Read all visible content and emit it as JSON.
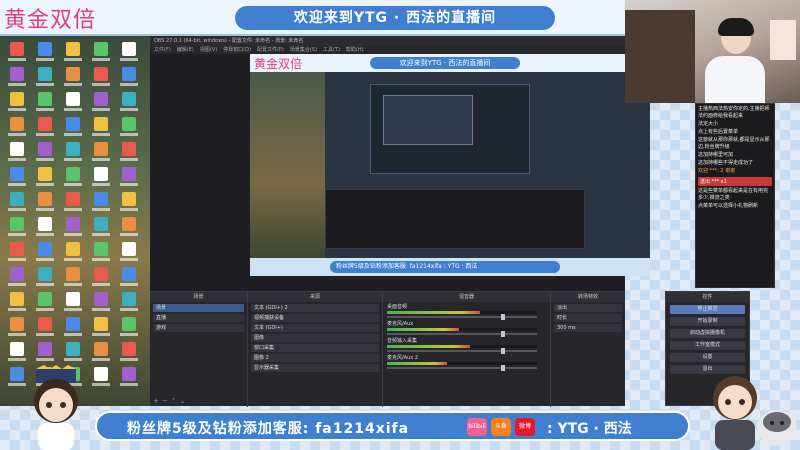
{
  "banner": {
    "promo_gold": "黄金双倍",
    "stream_title": "欢迎来到YTG · 西法的直播间"
  },
  "bottom_banner": {
    "fan_text": "粉丝牌5级及钻粉添加客服: fa1214xifa",
    "bilibili_label": "bilibili",
    "douyu_label": "斗鱼",
    "weibo_label": "微博",
    "weibo_account": ": YTG · 西法"
  },
  "preview": {
    "promo_gold": "黄金双倍",
    "stream_title": "欢迎来到YTG · 西法的直播间",
    "bottom_text": "粉丝牌5级及钻粉添加客服: fa1214xifa   : YTG · 西法"
  },
  "obs": {
    "window_title": "OBS 27.0.1 (64-bit, windows) - 配置文件: 未命名 - 场景: 未命名",
    "menu": [
      "文件(F)",
      "编辑(E)",
      "视图(V)",
      "停靠窗口(D)",
      "配置文件(P)",
      "场景集合(S)",
      "工具(T)",
      "帮助(H)"
    ],
    "docks": {
      "scenes": {
        "title": "场景",
        "items": [
          "场景",
          "直播",
          "游戏"
        ]
      },
      "sources": {
        "title": "来源",
        "items": [
          "文本 (GDI+) 2",
          "视频捕获设备",
          "文本 (GDI+)",
          "图像",
          "窗口采集",
          "图像 2",
          "显示器采集"
        ]
      },
      "mixer": {
        "title": "混音器",
        "tracks": [
          {
            "name": "桌面音频",
            "level": 0.62,
            "volume": 0.78
          },
          {
            "name": "麦克风/Aux",
            "level": 0.48,
            "volume": 0.78
          },
          {
            "name": "音频输入采集",
            "level": 0.55,
            "volume": 0.78
          },
          {
            "name": "麦克风/Aux 2",
            "level": 0.4,
            "volume": 0.78
          }
        ]
      },
      "transitions": {
        "title": "转场特效",
        "value": "淡出",
        "duration_label": "时长",
        "duration": "300 ms"
      },
      "controls": {
        "title": "控件",
        "buttons": [
          "停止推流",
          "开始录制",
          "启动虚拟摄像机",
          "工作室模式",
          "设置",
          "退出"
        ]
      }
    }
  },
  "chat": {
    "lines": [
      {
        "text": "主播热西法热安你定的,主播把师法约面修给我看起来",
        "style": "normal"
      },
      {
        "text": "法定大小",
        "style": "normal"
      },
      {
        "text": "点上有些后置菜单",
        "style": "normal"
      },
      {
        "text": "这窗就从那你那就,都是显示从那边,粉丝牌升级",
        "style": "normal"
      },
      {
        "text": "这加持哪里可加",
        "style": "normal"
      },
      {
        "text": "这加持哪些不得走成功了",
        "style": "normal"
      },
      {
        "text": "欢迎 ***: 2  谢谢",
        "style": "orange"
      },
      {
        "text": "这是些菜单都看起来是在有用完多少,推流之类",
        "style": "normal"
      },
      {
        "text": "点菜单可以选择小礼物刷新",
        "style": "normal"
      }
    ],
    "gift": "送出 ***  x1"
  },
  "colors": {
    "accent_blue": "#3f7fcf",
    "promo_pink": "#e23b8a",
    "obs_bg": "#1f1f23"
  }
}
